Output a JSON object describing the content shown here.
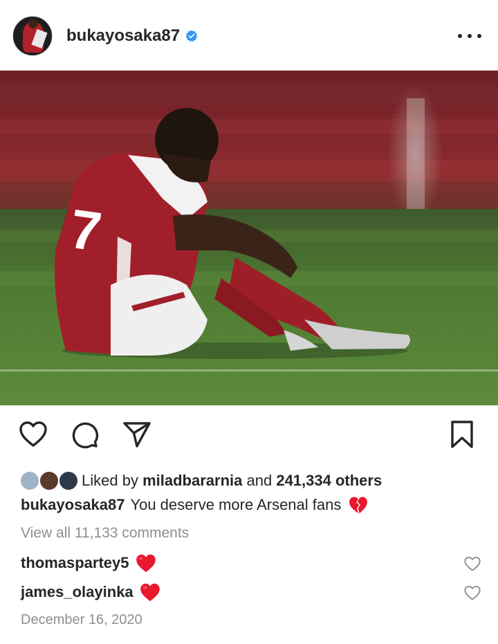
{
  "post": {
    "username": "bukayosaka87",
    "verified": true,
    "caption_user": "bukayosaka87",
    "caption_text": "You deserve more Arsenal fans",
    "caption_emoji": "broken-heart",
    "likes": {
      "prefix": "Liked by",
      "user": "miladbararnia",
      "connector": "and",
      "count": "241,334 others"
    },
    "view_comments": "View all 11,133 comments",
    "comments": [
      {
        "user": "thomaspartey5",
        "emoji": "red-heart"
      },
      {
        "user": "james_olayinka",
        "emoji": "red-heart"
      }
    ],
    "date": "December 16, 2020"
  },
  "icons": {
    "more": "more-options-icon",
    "like": "heart-icon",
    "comment": "comment-icon",
    "share": "share-icon",
    "save": "bookmark-icon"
  },
  "colors": {
    "verified_blue": "#3897f0",
    "text": "#262626",
    "muted": "#8e8e8e",
    "heart_red": "#e8192c"
  }
}
